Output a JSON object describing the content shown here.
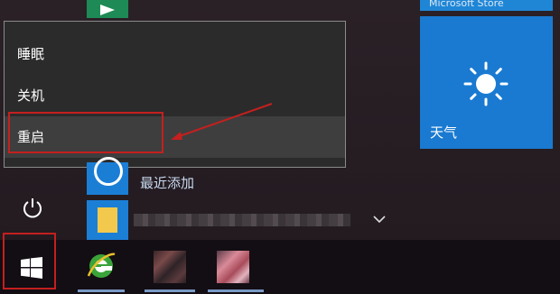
{
  "tiles": {
    "top_right_label": "Microsoft Store",
    "weather_label": "天气"
  },
  "power_menu": {
    "items": [
      {
        "label": "睡眠"
      },
      {
        "label": "关机"
      },
      {
        "label": "重启"
      }
    ],
    "highlighted_index": 2
  },
  "app_list": {
    "recent_label": "最近添加"
  },
  "colors": {
    "tile_blue": "#1a7ad1",
    "highlight_red": "#c3201f",
    "menu_bg": "#2b2b2b",
    "taskbar_bg": "#130e14"
  },
  "icons": [
    "power-icon",
    "windows-logo-icon",
    "internet-explorer-icon",
    "sun-icon",
    "chevron-down-icon",
    "folder-icon"
  ]
}
